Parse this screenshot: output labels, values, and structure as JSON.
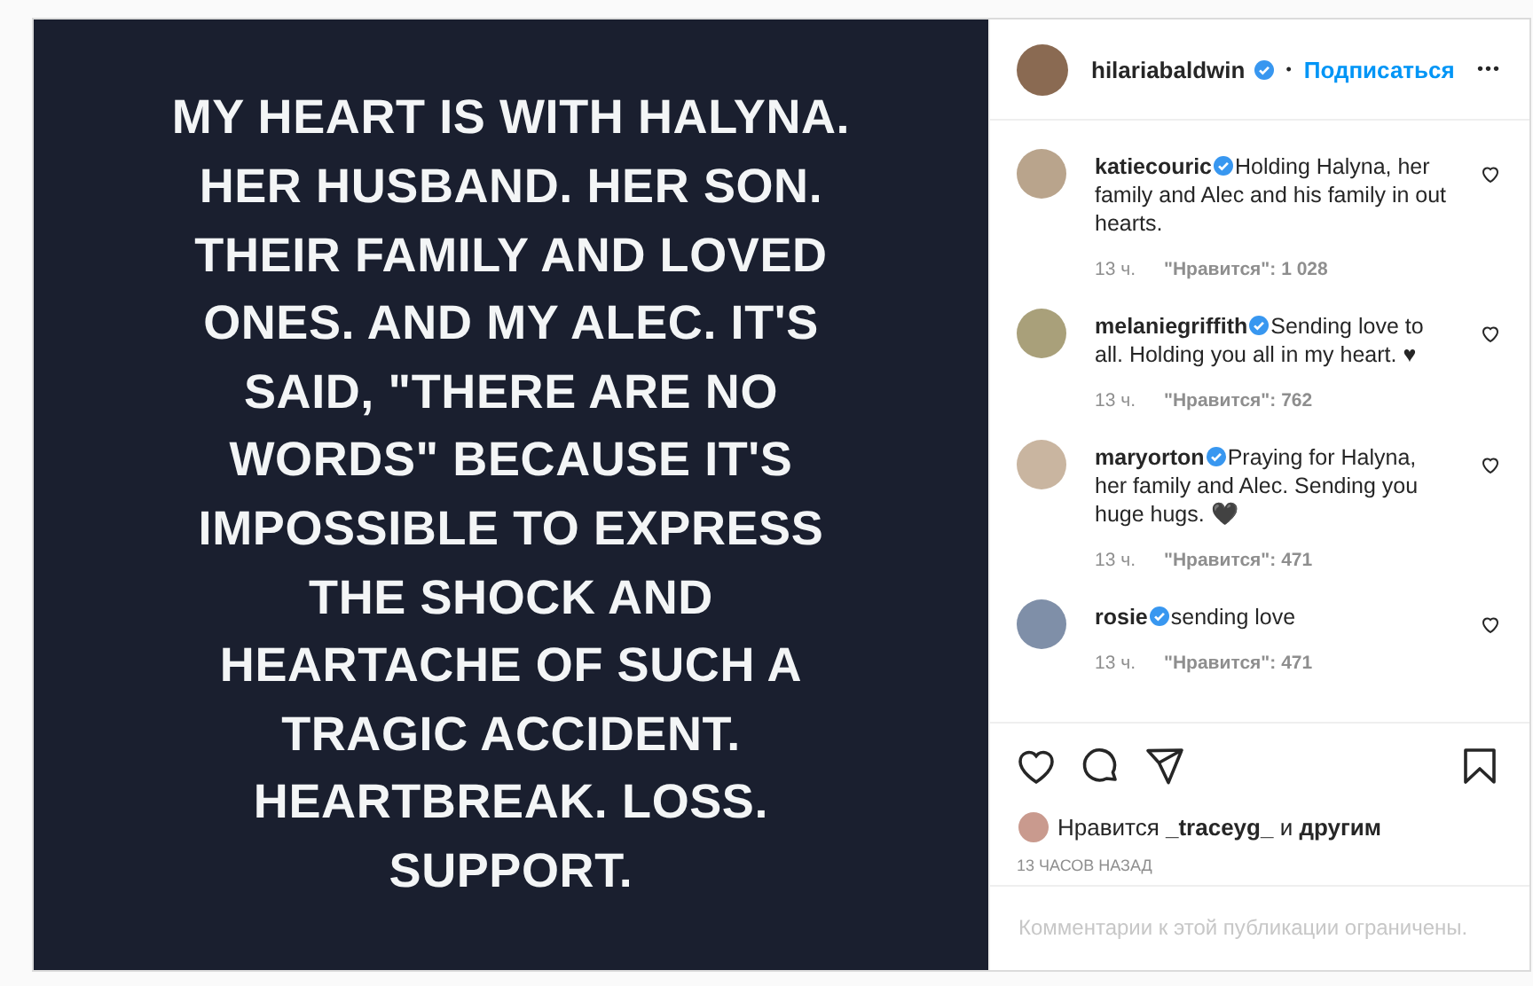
{
  "post_image": {
    "lines": [
      "MY HEART IS WITH HALYNA.",
      "HER HUSBAND. HER SON.",
      "THEIR FAMILY AND LOVED",
      "ONES. AND MY ALEC. IT'S",
      "SAID, \"THERE ARE NO",
      "WORDS\" BECAUSE IT'S",
      "IMPOSSIBLE TO EXPRESS",
      "THE SHOCK AND",
      "HEARTACHE OF SUCH A",
      "TRAGIC ACCIDENT.",
      "HEARTBREAK. LOSS.",
      "SUPPORT."
    ]
  },
  "header": {
    "username": "hilariabaldwin",
    "verified": true,
    "separator": "•",
    "follow": "Подписаться",
    "more": "•••"
  },
  "comments": [
    {
      "username": "katiecouric",
      "verified": true,
      "text": "Holding Halyna, her family and Alec and his family in out hearts.",
      "time": "13 ч.",
      "likes": "\"Нравится\": 1 028",
      "liked": false
    },
    {
      "username": "melaniegriffith",
      "verified": true,
      "text": "Sending love to all. Holding you all in my heart. ♥",
      "time": "13 ч.",
      "likes": "\"Нравится\": 762",
      "liked": false
    },
    {
      "username": "maryorton",
      "verified": true,
      "text": "Praying for Halyna, her family and Alec. Sending you huge hugs. 🖤",
      "time": "13 ч.",
      "likes": "\"Нравится\": 471",
      "liked": false
    },
    {
      "username": "rosie",
      "verified": true,
      "text": "sending love",
      "time": "13 ч.",
      "likes": "\"Нравится\": 471",
      "liked": false
    }
  ],
  "actions": {
    "liked": false,
    "saved": false
  },
  "likes_line": {
    "prefix": "Нравится",
    "user": "_traceyg_",
    "joiner": "и",
    "others": "другим"
  },
  "timestamp": "13 ЧАСОВ НАЗАД",
  "comments_notice": "Комментарии к этой публикации ограничены."
}
